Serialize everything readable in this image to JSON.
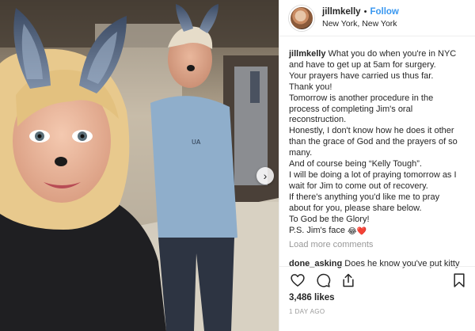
{
  "header": {
    "username": "jillmkelly",
    "separator": "•",
    "follow_label": "Follow",
    "location": "New York, New York"
  },
  "photo": {
    "next_arrow": "›",
    "sweater_logo": "UA"
  },
  "caption": {
    "author": "jillmkelly",
    "lines": [
      " What you do when you're in NYC",
      "and have to get up at 5am for surgery.",
      "Your prayers have carried us thus far.",
      "Thank you!",
      "Tomorrow is another procedure in the",
      "process of completing Jim's oral",
      "reconstruction.",
      "Honestly, I don't know how he does it other",
      "than the grace of God and the prayers of so",
      "many.",
      "And of course being “Kelly Tough”.",
      "I will be doing a lot of praying tomorrow as I",
      "wait for Jim to come out of recovery.",
      "If there's anything you'd like me to pray",
      "about for you, please share below.",
      "To God be the Glory!",
      "P.S. Jim's face "
    ],
    "emojis": [
      "😂",
      "❤️"
    ]
  },
  "load_more": "Load more comments",
  "comments": [
    {
      "user": "done_asking",
      "text": " Does he know you've put kitty"
    }
  ],
  "actions": {
    "icons": [
      "heart-icon",
      "comment-icon",
      "share-icon",
      "bookmark-icon"
    ]
  },
  "likes": "3,486 likes",
  "timestamp": "1 DAY AGO",
  "colors": {
    "link_blue": "#3897f0",
    "text": "#262626",
    "muted": "#999999"
  }
}
